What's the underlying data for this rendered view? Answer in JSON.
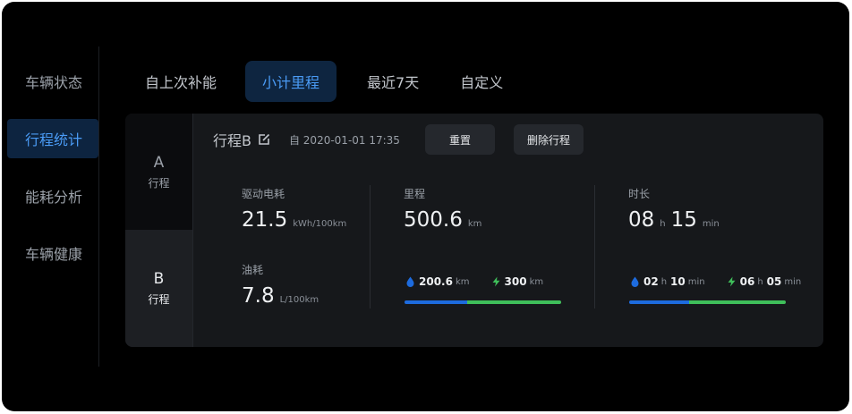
{
  "sidebar": {
    "items": [
      {
        "label": "车辆状态"
      },
      {
        "label": "行程统计"
      },
      {
        "label": "能耗分析"
      },
      {
        "label": "车辆健康"
      }
    ]
  },
  "tabs": [
    {
      "label": "自上次补能"
    },
    {
      "label": "小计里程"
    },
    {
      "label": "最近7天"
    },
    {
      "label": "自定义"
    }
  ],
  "trips": {
    "a": {
      "letter": "A",
      "sub": "行程"
    },
    "b": {
      "letter": "B",
      "sub": "行程"
    }
  },
  "header": {
    "trip_name": "行程B",
    "since": "自 2020-01-01  17:35",
    "reset_label": "重置",
    "delete_label": "删除行程"
  },
  "metrics": {
    "energy": {
      "label": "驱动电耗",
      "value": "21.5",
      "unit": "kWh/100km"
    },
    "fuel": {
      "label": "油耗",
      "value": "7.8",
      "unit": "L/100km"
    },
    "mileage": {
      "label": "里程",
      "value": "500.6",
      "unit": "km",
      "fuel_value": "200.6",
      "fuel_unit": "km",
      "elec_value": "300",
      "elec_unit": "km",
      "fuel_share": 0.4
    },
    "duration": {
      "label": "时长",
      "hours": "08",
      "hours_unit": "h",
      "minutes": "15",
      "minutes_unit": "min",
      "fuel_h": "02",
      "fuel_h_unit": "h",
      "fuel_m": "10",
      "fuel_m_unit": "min",
      "elec_h": "06",
      "elec_h_unit": "h",
      "elec_m": "05",
      "elec_m_unit": "min",
      "fuel_share": 0.38
    }
  },
  "icons": {
    "fuel": "water-drop-icon",
    "electric": "lightning-bolt-icon",
    "edit": "edit-icon"
  },
  "colors": {
    "accent": "#4a9bf5",
    "fuel": "#1d6bde",
    "electric": "#3fbe5a"
  }
}
